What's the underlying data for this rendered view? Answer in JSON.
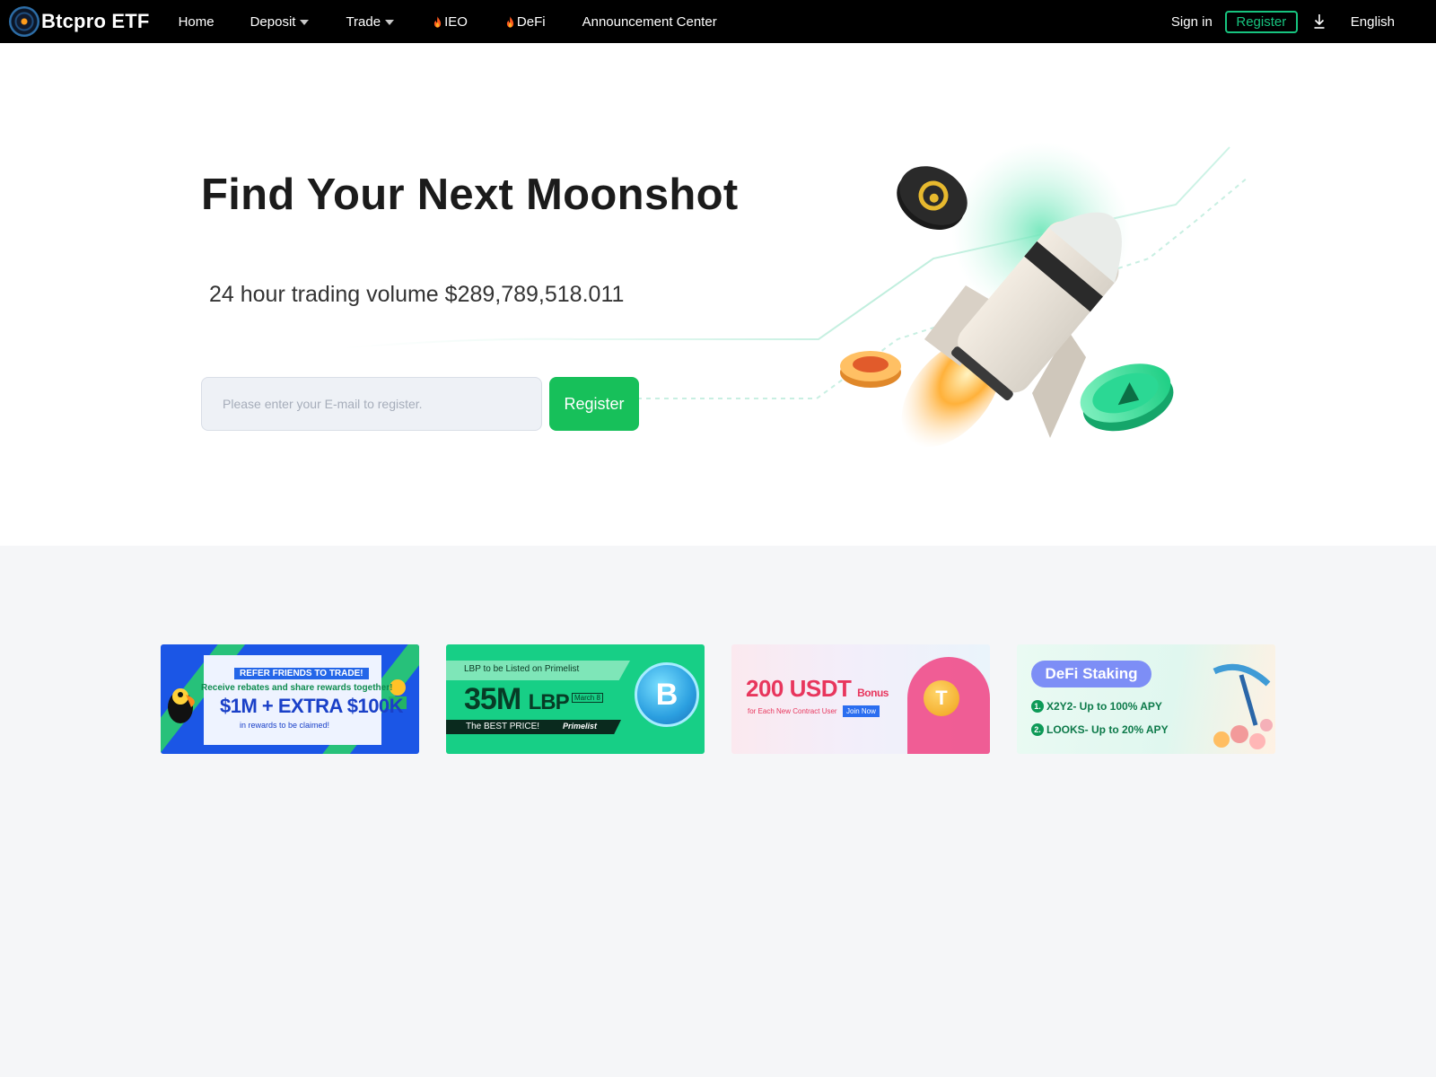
{
  "brand": {
    "name": "Btcpro ETF"
  },
  "nav": {
    "home": "Home",
    "deposit": "Deposit",
    "trade": "Trade",
    "ieo": "IEO",
    "defi": "DeFi",
    "announcements": "Announcement Center",
    "sign_in": "Sign in",
    "register": "Register",
    "language": "English"
  },
  "hero": {
    "headline": "Find Your Next Moonshot",
    "volume": "24 hour trading volume $289,789,518.011",
    "email_placeholder": "Please enter your E-mail to register.",
    "register_button": "Register"
  },
  "banners": [
    {
      "title": "REFER FRIENDS TO TRADE!",
      "line": "Receive rebates and share rewards together!",
      "amount": "$1M + EXTRA $100K",
      "sub": "in rewards to be claimed!"
    },
    {
      "top": "LBP to be Listed on Primelist",
      "big": "35M",
      "big_suffix": "LBP",
      "date": "March 8",
      "tagline": "The  BEST PRICE!",
      "brand": "Primelist",
      "coin_letter": "B"
    },
    {
      "amount": "200 USDT",
      "amount_suffix": "Bonus",
      "sub": "for Each New Contract User",
      "cta": "Join Now",
      "coin_letter": "T"
    },
    {
      "title": "DeFi Staking",
      "items": [
        {
          "num": "1.",
          "text": "X2Y2- Up to 100% APY"
        },
        {
          "num": "2.",
          "text": "LOOKS- Up to 20% APY"
        }
      ]
    }
  ],
  "colors": {
    "accent_green": "#17c05a",
    "register_outline": "#17c47f",
    "nav_bg": "#000000",
    "page_bg": "#f5f6f8"
  },
  "icons": {
    "download": "download-icon",
    "fire": "fire-icon",
    "caret": "chevron-down-icon"
  }
}
